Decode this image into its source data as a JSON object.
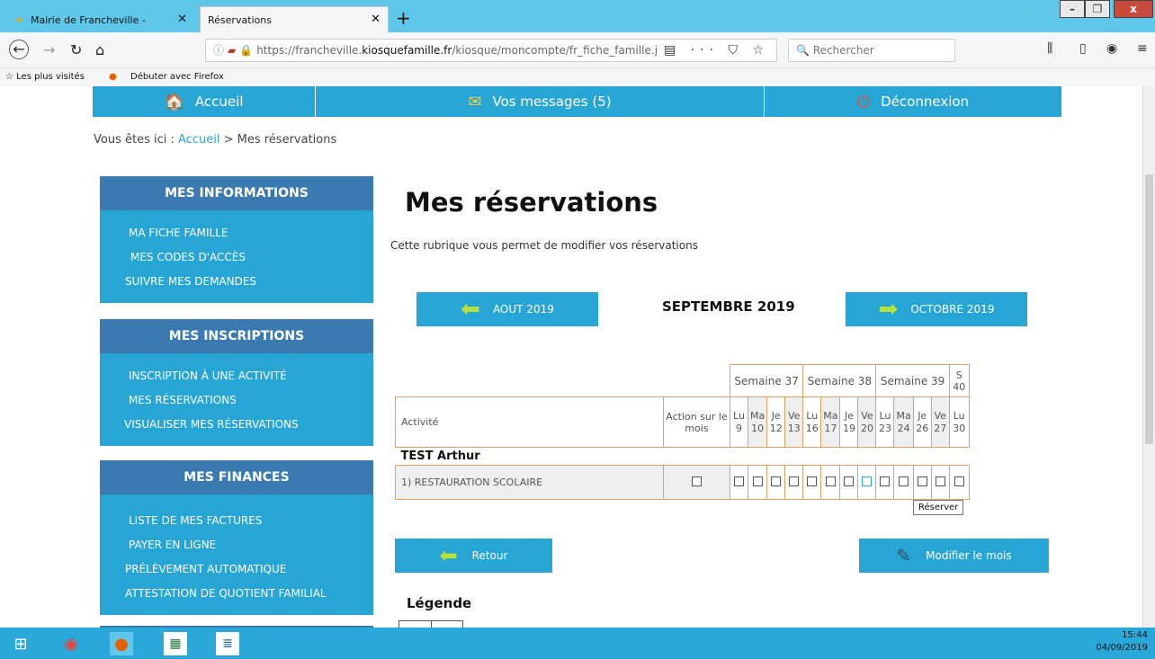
{
  "browser": {
    "tabs": [
      {
        "title": "Mairie de Francheville -",
        "active": false
      },
      {
        "title": "Réservations",
        "active": true
      }
    ],
    "new_tab": "+",
    "window_buttons": {
      "minimize": "–",
      "maximize": "❐",
      "close": "x"
    },
    "url_prefix": "https://francheville.",
    "url_domain": "kiosquefamille.fr",
    "url_path": "/kiosque/moncompte/fr_fiche_famille.j",
    "url_actions": "▤ ··· ⛉ ☆",
    "search_placeholder": "Rechercher",
    "bookmarks": [
      "Les plus visités",
      "Débuter avec Firefox"
    ]
  },
  "topnav": [
    {
      "label": "Accueil",
      "icon": "home-icon"
    },
    {
      "label": "Vos messages (5)",
      "icon": "envelope-icon"
    },
    {
      "label": "Déconnexion",
      "icon": "power-icon"
    }
  ],
  "breadcrumb": {
    "prefix": "Vous êtes ici :",
    "home": "Accueil",
    "separator": ">",
    "current": "Mes réservations"
  },
  "sidebar": [
    {
      "title": "MES INFORMATIONS",
      "links": [
        "MA FICHE FAMILLE",
        "MES CODES D'ACCÈS",
        "SUIVRE MES DEMANDES"
      ]
    },
    {
      "title": "MES INSCRIPTIONS",
      "links": [
        "INSCRIPTION À UNE ACTIVITÉ",
        "MES RÉSERVATIONS",
        "VISUALISER MES RÉSERVATIONS"
      ]
    },
    {
      "title": "MES FINANCES",
      "links": [
        "LISTE DE MES FACTURES",
        "PAYER EN LIGNE",
        "PRÉLÈVEMENT AUTOMATIQUE",
        "ATTESTATION DE QUOTIENT FAMILIAL"
      ]
    }
  ],
  "main": {
    "title": "Mes réservations",
    "subtitle": "Cette rubrique vous permet de modifier vos réservations",
    "prev_month": "AOUT 2019",
    "current_month": "SEPTEMBRE 2019",
    "next_month": "OCTOBRE 2019"
  },
  "table": {
    "activity_header": "Activité",
    "action_header": "Action sur le mois",
    "weeks": [
      {
        "label": "Semaine 37",
        "span": 4
      },
      {
        "label": "Semaine 38",
        "span": 4
      },
      {
        "label": "Semaine 39",
        "span": 4
      },
      {
        "label": "S 40",
        "span": 1
      }
    ],
    "days": [
      {
        "d": "Lu",
        "n": "9"
      },
      {
        "d": "Ma",
        "n": "10"
      },
      {
        "d": "Je",
        "n": "12"
      },
      {
        "d": "Ve",
        "n": "13"
      },
      {
        "d": "Lu",
        "n": "16"
      },
      {
        "d": "Ma",
        "n": "17"
      },
      {
        "d": "Je",
        "n": "19"
      },
      {
        "d": "Ve",
        "n": "20"
      },
      {
        "d": "Lu",
        "n": "23"
      },
      {
        "d": "Ma",
        "n": "24"
      },
      {
        "d": "Je",
        "n": "26"
      },
      {
        "d": "Ve",
        "n": "27"
      },
      {
        "d": "Lu",
        "n": "30"
      }
    ],
    "child": "TEST Arthur",
    "activity": "1) RESTAURATION SCOLAIRE",
    "tooltip": "Réserver"
  },
  "actions": {
    "back": "Retour",
    "modify": "Modifier le mois"
  },
  "legend_title": "Légende",
  "taskbar": {
    "time": "15:44",
    "date": "04/09/2019"
  }
}
